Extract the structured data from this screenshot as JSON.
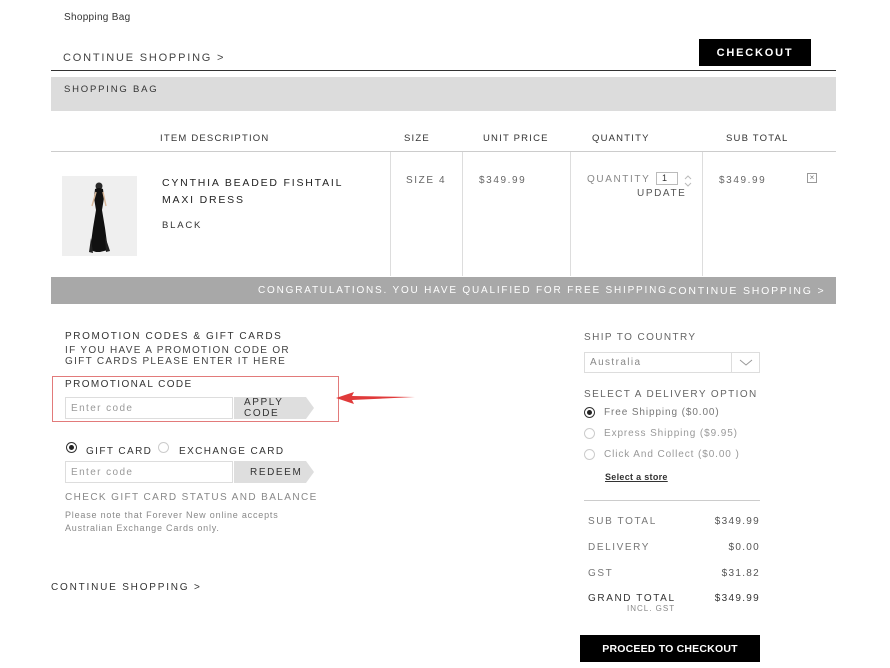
{
  "page": {
    "label": "Shopping Bag",
    "continue_top": "CONTINUE SHOPPING >",
    "checkout_label": "CHECKOUT",
    "bag_bar": "SHOPPING BAG"
  },
  "table": {
    "headers": {
      "item": "ITEM DESCRIPTION",
      "size": "SIZE",
      "unit_price": "UNIT PRICE",
      "quantity": "QUANTITY",
      "sub_total": "SUB TOTAL"
    },
    "item": {
      "name": "CYNTHIA BEADED FISHTAIL MAXI DRESS",
      "color": "BLACK",
      "size": "SIZE 4",
      "unit_price": "$349.99",
      "quantity_label": "QUANTITY",
      "quantity": "1",
      "update_label": "UPDATE",
      "sub_total": "$349.99",
      "remove": "×"
    }
  },
  "shipping_bar": {
    "message": "CONGRATULATIONS. YOU HAVE QUALIFIED FOR FREE SHIPPING.",
    "continue": "CONTINUE SHOPPING >"
  },
  "promo": {
    "heading": "PROMOTION CODES & GIFT CARDS",
    "sub": "IF YOU HAVE A PROMOTION CODE OR GIFT CARDS PLEASE ENTER IT HERE",
    "label": "PROMOTIONAL CODE",
    "placeholder": "Enter code",
    "apply_label": "APPLY CODE"
  },
  "gift": {
    "gift_card_label": "GIFT CARD",
    "exchange_card_label": "EXCHANGE CARD",
    "placeholder": "Enter code",
    "redeem_label": "REDEEM",
    "status_link": "CHECK GIFT CARD STATUS AND BALANCE",
    "note": "Please note that Forever New online accepts Australian Exchange Cards only."
  },
  "continue_bottom": "CONTINUE SHOPPING >",
  "shipping": {
    "country_heading": "SHIP TO COUNTRY",
    "country_value": "Australia",
    "delivery_heading": "SELECT A DELIVERY OPTION",
    "options": [
      {
        "label": "Free Shipping ($0.00)",
        "selected": true
      },
      {
        "label": "Express Shipping ($9.95)",
        "selected": false
      },
      {
        "label": "Click And Collect ($0.00 )",
        "selected": false
      }
    ],
    "store_link": "Select a store"
  },
  "summary": {
    "sub_total_label": "SUB TOTAL",
    "sub_total": "$349.99",
    "delivery_label": "DELIVERY",
    "delivery": "$0.00",
    "gst_label": "GST",
    "gst": "$31.82",
    "grand_total_label": "GRAND TOTAL",
    "incl_gst": "INCL. GST",
    "grand_total": "$349.99",
    "proceed_label": "PROCEED TO CHECKOUT"
  },
  "colors": {
    "annotation_red": "#e03a3a",
    "bar_gray": "#dcdcdc",
    "ship_bar_gray": "#a8a8a8",
    "button_black": "#000000"
  }
}
